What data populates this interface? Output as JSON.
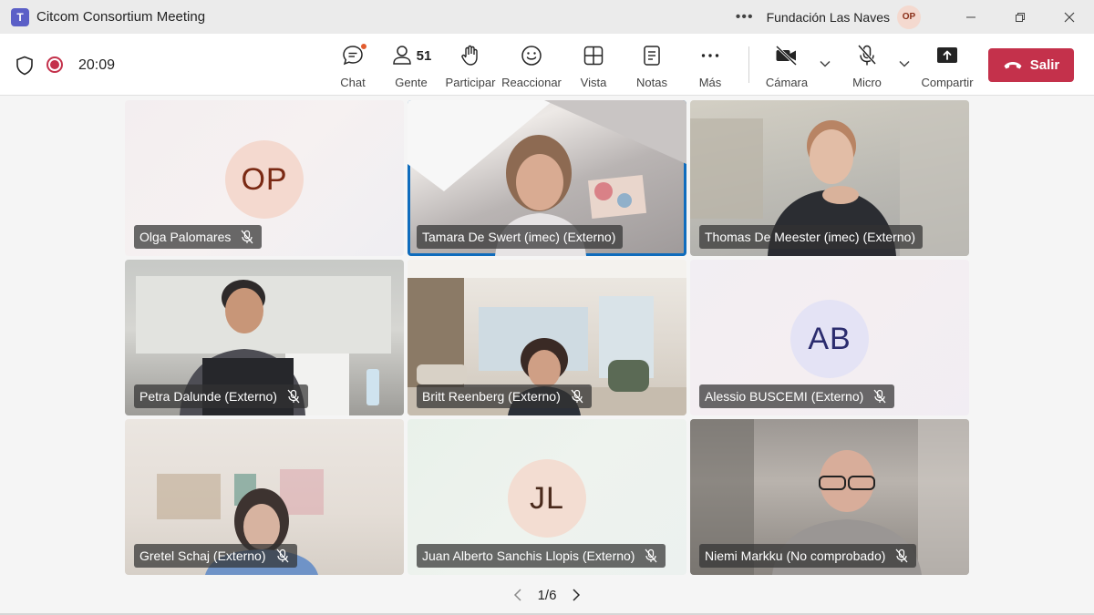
{
  "window": {
    "title": "Citcom Consortium Meeting",
    "org_name": "Fundación Las Naves",
    "user_initials": "OP",
    "more_label": "•••"
  },
  "toolbar": {
    "timer": "20:09",
    "people_count": "51",
    "items": {
      "chat": "Chat",
      "people": "Gente",
      "raise_hand": "Participar",
      "react": "Reaccionar",
      "view": "Vista",
      "notes": "Notas",
      "more": "Más",
      "camera": "Cámara",
      "mic": "Micro",
      "share": "Compartir"
    },
    "leave_label": "Salir",
    "accent_leave": "#c4314b",
    "accent_brand": "#5b5fc7"
  },
  "participants": [
    {
      "name": "Olga Palomares",
      "initials": "OP",
      "type": "avatar",
      "muted": true
    },
    {
      "name": "Tamara De Swert (imec) (Externo)",
      "type": "video",
      "muted": false,
      "active_speaker": true
    },
    {
      "name": "Thomas De Meester (imec) (Externo)",
      "type": "video",
      "muted": false
    },
    {
      "name": "Petra Dalunde (Externo)",
      "type": "video",
      "muted": true
    },
    {
      "name": "Britt Reenberg (Externo)",
      "type": "video",
      "muted": true
    },
    {
      "name": "Alessio BUSCEMI (Externo)",
      "initials": "AB",
      "type": "avatar",
      "muted": true
    },
    {
      "name": "Gretel Schaj (Externo)",
      "type": "video",
      "muted": true
    },
    {
      "name": "Juan Alberto Sanchis Llopis (Externo)",
      "initials": "JL",
      "type": "avatar",
      "muted": true
    },
    {
      "name": "Niemi Markku (No comprobado)",
      "type": "video",
      "muted": true
    }
  ],
  "pagination": {
    "text": "1/6"
  }
}
